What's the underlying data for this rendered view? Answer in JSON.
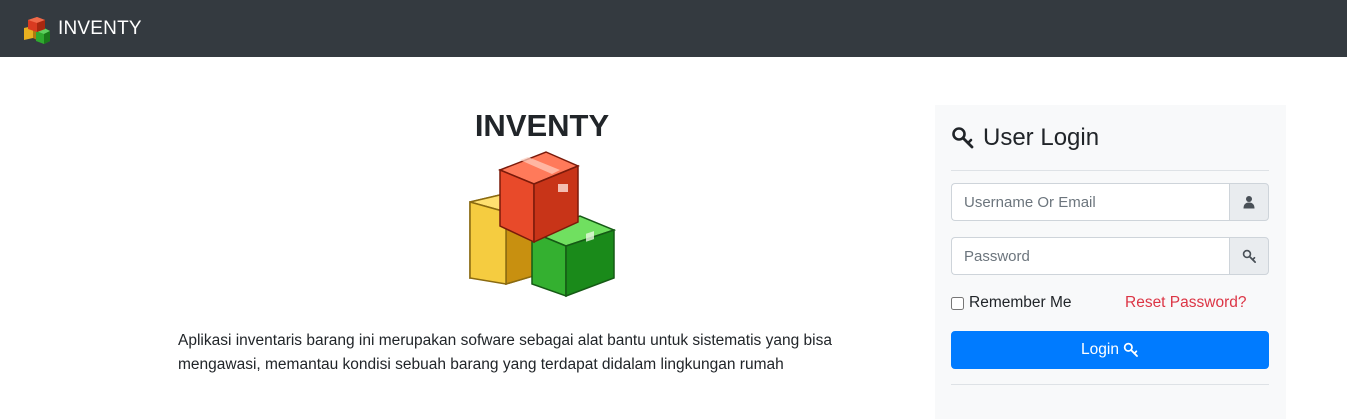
{
  "navbar": {
    "brand": "INVENTY",
    "logo_icon": "boxes-icon"
  },
  "hero": {
    "title": "INVENTY",
    "image_icon": "boxes-icon",
    "description_line1": "Aplikasi inventaris barang ini merupakan sofware sebagai alat bantu untuk sistematis yang bisa",
    "description_line2": "mengawasi, memantau kondisi sebuah barang yang terdapat didalam lingkungan rumah"
  },
  "login": {
    "title": "User Login",
    "title_icon": "key-icon",
    "username_placeholder": "Username Or Email",
    "username_value": "",
    "username_icon": "user-icon",
    "password_placeholder": "Password",
    "password_value": "",
    "password_icon": "key-icon",
    "remember_label": "Remember Me",
    "remember_checked": false,
    "reset_label": "Reset Password?",
    "button_label": "Login",
    "button_icon": "key-icon"
  },
  "colors": {
    "navbar_bg": "#343a40",
    "primary": "#007bff",
    "danger": "#dc3545",
    "card_bg": "#f8f9fa"
  }
}
